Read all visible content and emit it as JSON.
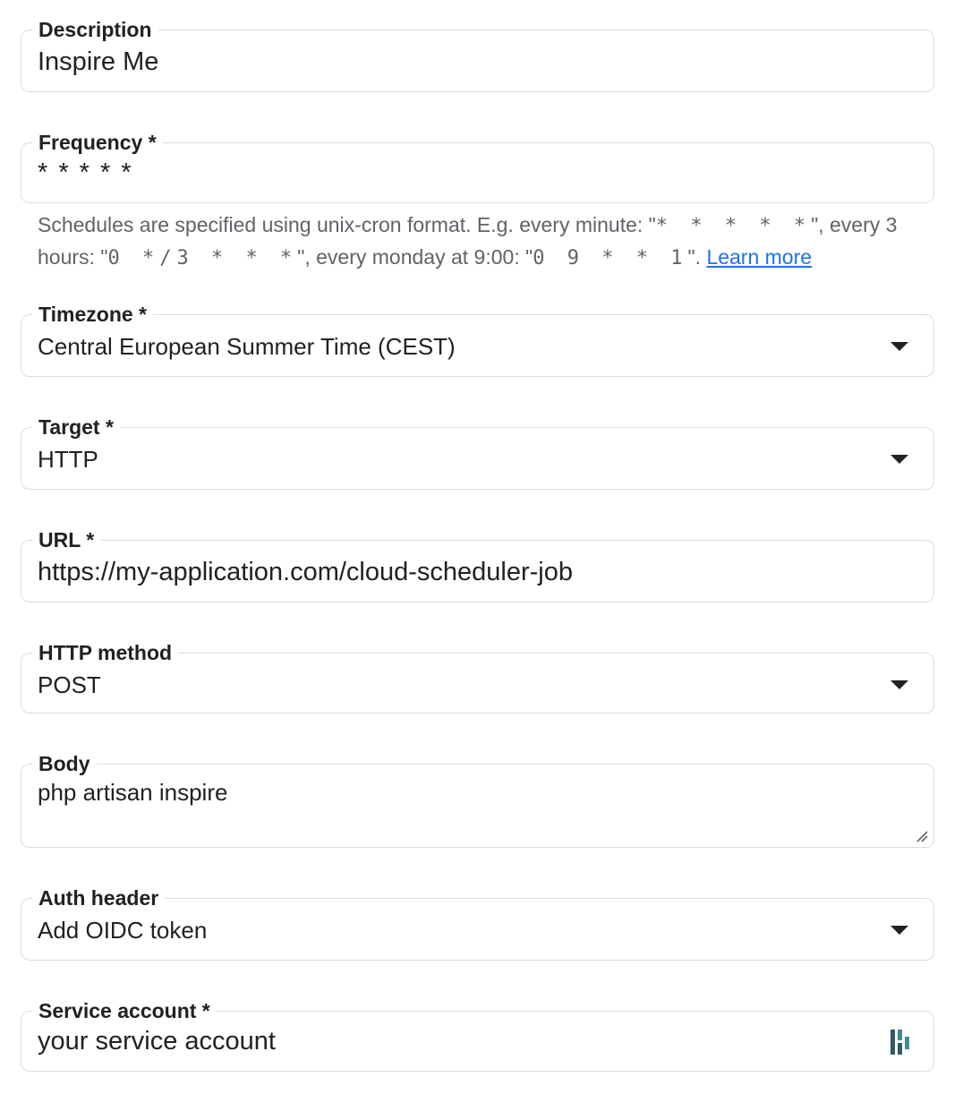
{
  "fields": {
    "description": {
      "label": "Description",
      "value": "Inspire Me"
    },
    "frequency": {
      "label": "Frequency *",
      "value": "* * * * *",
      "hint": {
        "t1": "Schedules are specified using unix-cron format. E.g. every minute: \"",
        "c1": "* * * * *",
        "t2": "\", every 3 hours: \"",
        "c2": "0 */3 * * *",
        "t3": "\", every monday at 9:00: \"",
        "c3": "0 9 * * 1",
        "t4": "\". ",
        "link": "Learn more"
      }
    },
    "timezone": {
      "label": "Timezone *",
      "value": "Central European Summer Time (CEST)"
    },
    "target": {
      "label": "Target *",
      "value": "HTTP"
    },
    "url": {
      "label": "URL *",
      "value": "https://my-application.com/cloud-scheduler-job"
    },
    "http_method": {
      "label": "HTTP method",
      "value": "POST"
    },
    "body": {
      "label": "Body",
      "value": "php artisan inspire"
    },
    "auth_header": {
      "label": "Auth header",
      "value": "Add OIDC token"
    },
    "service_account": {
      "label": "Service account *",
      "value": "your service account",
      "icon": "password-manager-icon"
    }
  }
}
